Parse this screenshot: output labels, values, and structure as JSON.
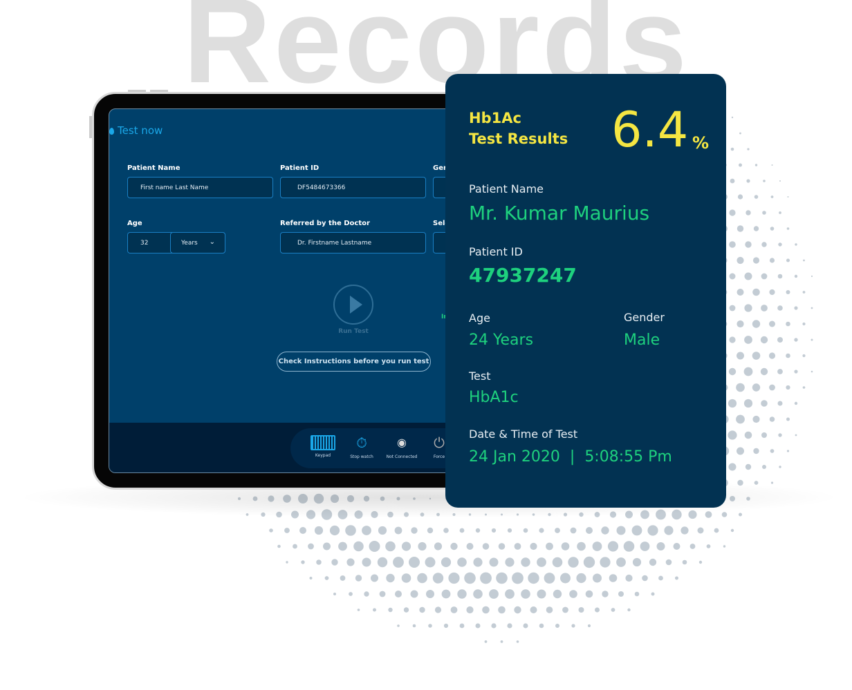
{
  "headline": "Records",
  "tablet": {
    "title": "Test now",
    "fields": {
      "patient_name": {
        "label": "Patient Name",
        "value": "First name Last Name"
      },
      "patient_id": {
        "label": "Patient ID",
        "value": "DF5484673366"
      },
      "gender_label_fragment": "Ger",
      "age": {
        "label": "Age",
        "value": "32",
        "unit": "Years"
      },
      "doctor": {
        "label": "Referred by the Doctor",
        "value": "Dr. Firstname Lastname"
      },
      "select_label_fragment": "Sele"
    },
    "run_test": "Run Test",
    "green_fragment": "In",
    "check_instructions": "Check Instructions before you run test",
    "dock": [
      {
        "label": "Keypad",
        "icon": "keyboard-icon"
      },
      {
        "label": "Stop watch",
        "icon": "stopwatch-icon"
      },
      {
        "label": "Not Connected",
        "icon": "wifi-icon"
      },
      {
        "label": "Force",
        "icon": "power-icon"
      }
    ]
  },
  "card": {
    "test_name": "Hb1Ac",
    "subtitle": "Test Results",
    "value": "6.4",
    "unit": "%",
    "patient_name_label": "Patient Name",
    "patient_name": "Mr. Kumar Maurius",
    "patient_id_label": "Patient ID",
    "patient_id": "47937247",
    "age_label": "Age",
    "age": "24 Years",
    "gender_label": "Gender",
    "gender": "Male",
    "test_label": "Test",
    "test": "HbA1c",
    "datetime_label": "Date & Time of Test",
    "date": "24 Jan 2020",
    "separator": "|",
    "time": "5:08:55 Pm",
    "colors": {
      "background": "#023252",
      "highlight": "#f5e642",
      "value": "#1ed17e"
    }
  }
}
